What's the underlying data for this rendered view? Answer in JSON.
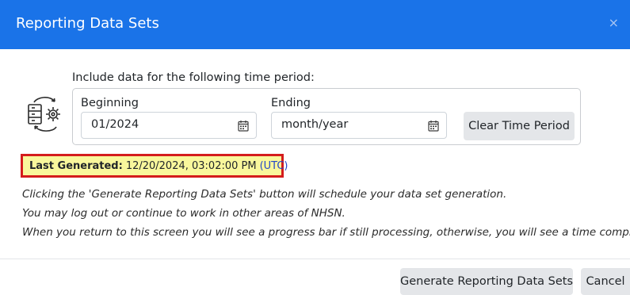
{
  "dialog": {
    "title": "Reporting Data Sets",
    "close_label": "×"
  },
  "time_period": {
    "intro": "Include data for the following time period:",
    "beginning_label": "Beginning",
    "beginning_value": "01/2024",
    "ending_label": "Ending",
    "ending_placeholder": "month/year",
    "clear_button": "Clear Time Period"
  },
  "last_generated": {
    "label": "Last Generated:",
    "value": "12/20/2024, 03:02:00 PM",
    "timezone": "(UTC)"
  },
  "notes": [
    "Clicking the 'Generate Reporting Data Sets' button will schedule your data set generation.",
    "You may log out or continue to work in other areas of NHSN.",
    "When you return to this screen you will see a progress bar if still processing, otherwise, you will see a time completed."
  ],
  "footer": {
    "generate_button": "Generate Reporting Data Sets",
    "cancel_button": "Cancel"
  },
  "colors": {
    "header": "#1a73e8",
    "highlight": "#f9f79c",
    "highlight_border": "#d41c1c"
  },
  "icons": {
    "dataset": "database-refresh-gear-icon",
    "calendar": "calendar-icon",
    "close": "close-icon"
  }
}
